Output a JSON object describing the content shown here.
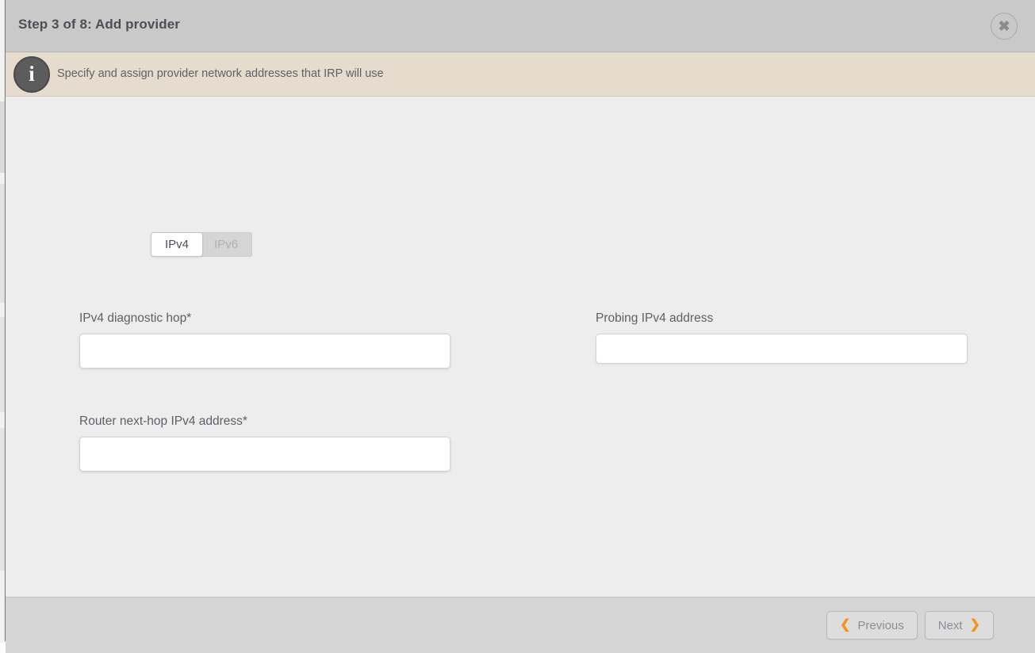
{
  "backdrop": {
    "note": "page content partially visible at left edge"
  },
  "dialog": {
    "title": "Step 3 of 8: Add provider",
    "close_button_label": "✖",
    "close_icon": "close-icon"
  },
  "info_banner": {
    "icon": "info-icon",
    "icon_glyph": "i",
    "message": "Specify and assign provider network addresses that IRP will use"
  },
  "tabs": [
    {
      "label": "IPv4",
      "state": "active"
    },
    {
      "label": "IPv6",
      "state": "inactive"
    }
  ],
  "fields": {
    "diagnostic_hop": {
      "label": "IPv4 diagnostic hop*",
      "value": "",
      "placeholder": ""
    },
    "router_nexthop": {
      "label": "Router next-hop IPv4 address*",
      "value": "",
      "placeholder": ""
    },
    "probing_address": {
      "label": "Probing IPv4 address",
      "value": "",
      "placeholder": ""
    }
  },
  "footer": {
    "previous_label": "Previous",
    "previous_chevron": "❮",
    "next_label": "Next",
    "next_chevron": "❯"
  },
  "colors": {
    "titlebar_bg": "#c9c9c9",
    "info_banner_bg": "#e5dcce",
    "body_bg": "#ededed",
    "footer_bg": "#d6d5d5",
    "accent_orange": "#f5931e",
    "text_slate": "#5d6167"
  }
}
